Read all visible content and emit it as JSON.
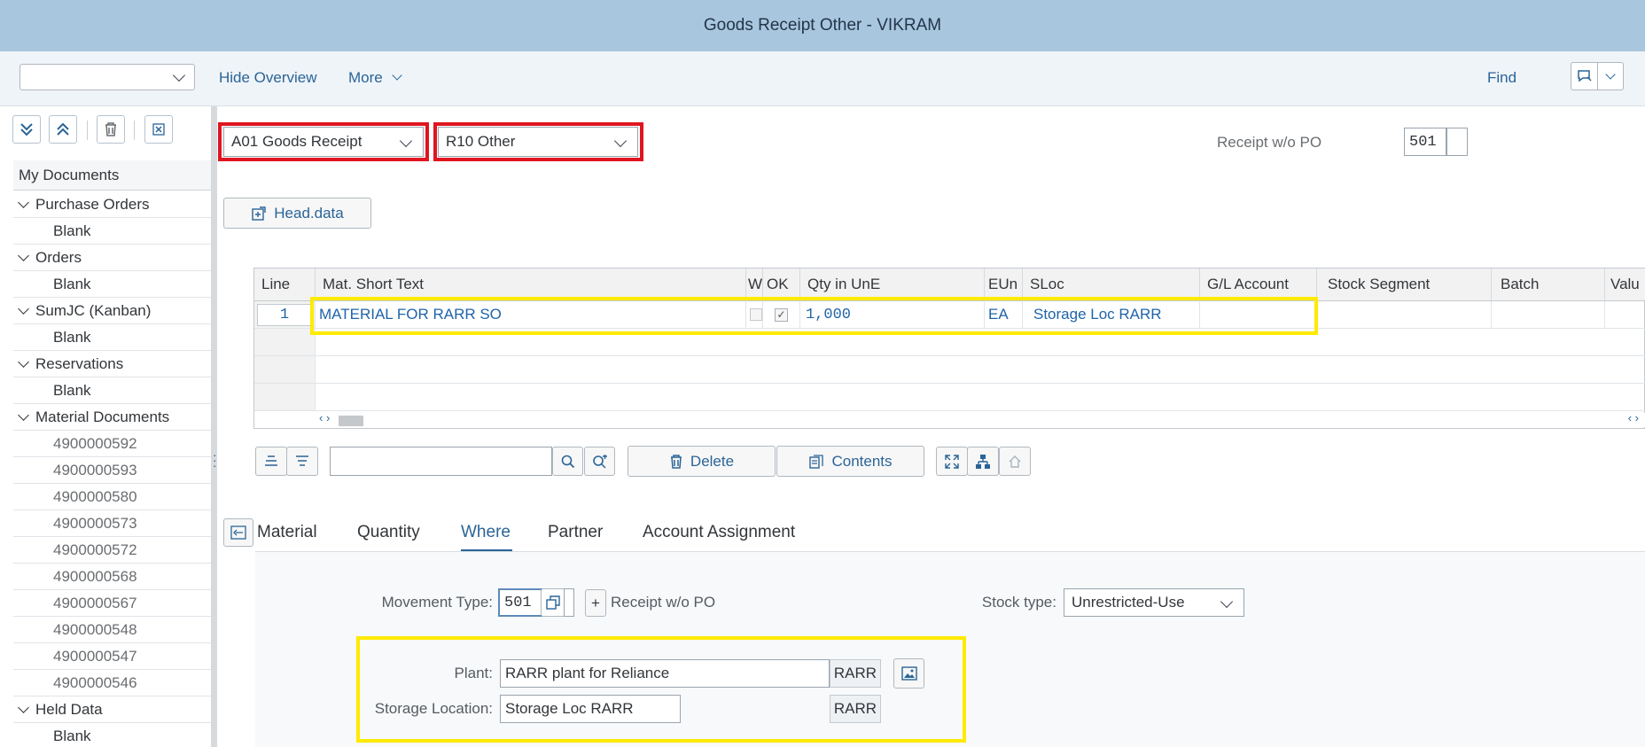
{
  "title": "Goods Receipt Other - VIKRAM",
  "toolbar": {
    "hide_overview": "Hide Overview",
    "more": "More",
    "find": "Find"
  },
  "left_panel": {
    "header": "My Documents",
    "tree": [
      {
        "label": "Purchase Orders",
        "type": "folder"
      },
      {
        "label": "Blank",
        "type": "leaf"
      },
      {
        "label": "Orders",
        "type": "folder"
      },
      {
        "label": "Blank",
        "type": "leaf"
      },
      {
        "label": "SumJC (Kanban)",
        "type": "folder"
      },
      {
        "label": "Blank",
        "type": "leaf"
      },
      {
        "label": "Reservations",
        "type": "folder"
      },
      {
        "label": "Blank",
        "type": "leaf"
      },
      {
        "label": "Material Documents",
        "type": "folder"
      },
      {
        "label": "4900000592",
        "type": "doc"
      },
      {
        "label": "4900000593",
        "type": "doc"
      },
      {
        "label": "4900000580",
        "type": "doc"
      },
      {
        "label": "4900000573",
        "type": "doc"
      },
      {
        "label": "4900000572",
        "type": "doc"
      },
      {
        "label": "4900000568",
        "type": "doc"
      },
      {
        "label": "4900000567",
        "type": "doc"
      },
      {
        "label": "4900000548",
        "type": "doc"
      },
      {
        "label": "4900000547",
        "type": "doc"
      },
      {
        "label": "4900000546",
        "type": "doc"
      },
      {
        "label": "Held Data",
        "type": "folder"
      },
      {
        "label": "Blank",
        "type": "leaf"
      }
    ]
  },
  "header": {
    "transaction": "A01 Goods Receipt",
    "reference": "R10 Other",
    "movement_label": "Receipt w/o PO",
    "movement_code": "501",
    "head_data": "Head.data"
  },
  "grid": {
    "columns": [
      "Line",
      "Mat. Short Text",
      "W",
      "OK",
      "Qty in UnE",
      "EUn",
      "SLoc",
      "G/L Account",
      "Stock Segment",
      "Batch",
      "Valu"
    ],
    "row": {
      "line": "1",
      "material": "MATERIAL FOR RARR SO",
      "qty": "1,000",
      "eun": "EA",
      "sloc": "Storage Loc RARR"
    }
  },
  "grid_toolbar": {
    "delete": "Delete",
    "contents": "Contents"
  },
  "tabs": [
    "Material",
    "Quantity",
    "Where",
    "Partner",
    "Account Assignment"
  ],
  "detail": {
    "movement_type_label": "Movement Type:",
    "movement_type_value": "501",
    "plus": "+",
    "movement_desc": "Receipt w/o PO",
    "stock_type_label": "Stock type:",
    "stock_type_value": "Unrestricted-Use",
    "plant_label": "Plant:",
    "plant_value": "RARR plant for Reliance",
    "plant_code": "RARR",
    "sloc_label": "Storage Location:",
    "sloc_value": "Storage Loc RARR",
    "sloc_code": "RARR"
  },
  "colors": {
    "title_bar": "#a9c6df",
    "highlight_red": "#e0151f",
    "highlight_yellow": "#ffea00",
    "link_blue": "#2a6496"
  }
}
